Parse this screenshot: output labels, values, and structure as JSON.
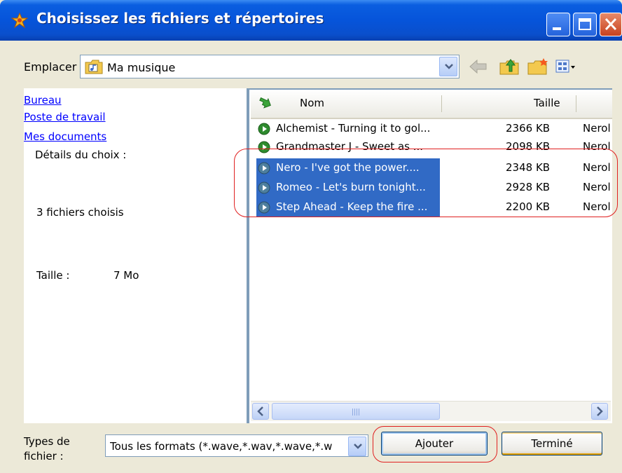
{
  "window": {
    "title": "Choisissez les fichiers et répertoires",
    "title_icon": "app-star-icon",
    "controls": [
      "minimize-icon",
      "maximize-icon",
      "close-icon"
    ]
  },
  "location": {
    "label": "Emplacer",
    "value": "Ma musique",
    "folder_icon": "music-folder-icon",
    "toolbar_icons": [
      "back-arrow-icon",
      "up-folder-icon",
      "new-folder-icon",
      "view-menu-icon"
    ]
  },
  "left_pane": {
    "links": [
      "Bureau",
      "Poste de travail",
      "Mes documents"
    ],
    "details_label": "Détails du choix :",
    "count_text": "3 fichiers choisis",
    "size_label": "Taille :",
    "size_value": "7 Mo"
  },
  "file_list": {
    "columns": [
      "Nom",
      "Taille"
    ],
    "rows": [
      {
        "name": "Alchemist - Turning it to gol...",
        "size": "2366 KB",
        "type": "Nerol",
        "selected": false
      },
      {
        "name": "Grandmaster J - Sweet as ...",
        "size": "2098 KB",
        "type": "Nerol",
        "selected": false
      },
      {
        "name": "Nero -  I've got the power....",
        "size": "2348 KB",
        "type": "Nerol",
        "selected": true
      },
      {
        "name": "Romeo -  Let's burn tonight...",
        "size": "2928 KB",
        "type": "Nerol",
        "selected": true
      },
      {
        "name": "Step Ahead - Keep the fire ...",
        "size": "2200 KB",
        "type": "Nerol",
        "selected": true
      }
    ]
  },
  "footer": {
    "types_label_line1": "Types de",
    "types_label_line2": "fichier :",
    "types_value": "Tous les formats  (*.wave,*.wav,*.wave,*.w",
    "add_button": "Ajouter",
    "done_button": "Terminé"
  },
  "colors": {
    "title_blue": "#0654DA",
    "selection": "#316AC5",
    "link": "#0000FF",
    "annotation_red": "#E02020",
    "dialog_bg": "#ECE9D8"
  }
}
